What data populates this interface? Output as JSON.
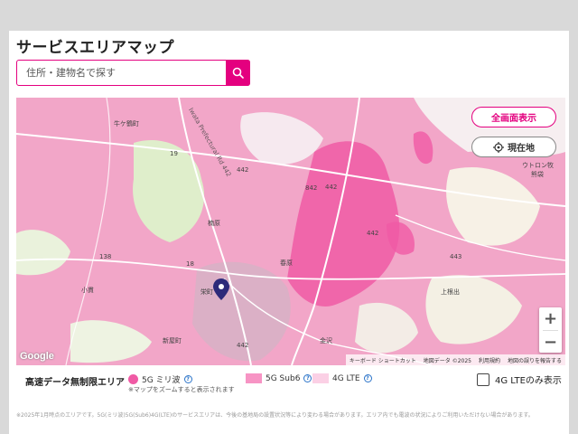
{
  "page": {
    "title": "サービスエリアマップ"
  },
  "search": {
    "placeholder": "住所・建物名で探す",
    "button_icon": "search-icon"
  },
  "map": {
    "fullscreen_label": "全画面表示",
    "current_location_label": "現在地",
    "zoom_in": "+",
    "zoom_out": "−",
    "google_logo": "Google",
    "attribution": {
      "shortcuts": "キーボード ショートカット",
      "map_data": "地図データ ©2025",
      "terms": "利用規約",
      "report": "地図の誤りを報告する"
    },
    "labels": [
      {
        "key": "ushikubi",
        "text": "牛ケ鶴町"
      },
      {
        "key": "route442a",
        "text": "442"
      },
      {
        "key": "route19",
        "text": "19"
      },
      {
        "key": "route442b",
        "text": "442"
      },
      {
        "key": "route842",
        "text": "842"
      },
      {
        "key": "utoron",
        "text": "ウトロン牧"
      },
      {
        "key": "kumabukuro",
        "text": "熊袋"
      },
      {
        "key": "yanagihara",
        "text": "楠原"
      },
      {
        "key": "route138",
        "text": "138"
      },
      {
        "key": "route18",
        "text": "18"
      },
      {
        "key": "route443",
        "text": "443"
      },
      {
        "key": "route442c",
        "text": "442"
      },
      {
        "key": "harubara",
        "text": "春原"
      },
      {
        "key": "sakaemachi",
        "text": "栄町"
      },
      {
        "key": "kojiki",
        "text": "小貫"
      },
      {
        "key": "kamiizumi",
        "text": "上根出"
      },
      {
        "key": "niiyamachi",
        "text": "新屋町"
      },
      {
        "key": "kanazawa",
        "text": "金沢"
      },
      {
        "key": "route442d",
        "text": "442"
      },
      {
        "key": "prefrd",
        "text": "Iwata Prefectural Rd 442"
      }
    ]
  },
  "legend": {
    "title": "高速データ無制限エリア",
    "items": [
      {
        "label": "5G ミリ波",
        "color": "#f05aa5"
      },
      {
        "label": "5G Sub6",
        "color": "#f794c4"
      },
      {
        "label": "4G LTE",
        "color": "#fbd0e5"
      }
    ],
    "note": "※マップをズームすると表示されます",
    "lte_only_label": "4G LTEのみ表示"
  },
  "footer": {
    "text": "※2025年1月時点のエリアです。5G(ミリ波)5G(Sub6)4G(LTE)のサービスエリアは、今後の基地局の設置状況等により変わる場合があります。エリア内でも電波の状況によりご利用いただけない場合があります。"
  }
}
